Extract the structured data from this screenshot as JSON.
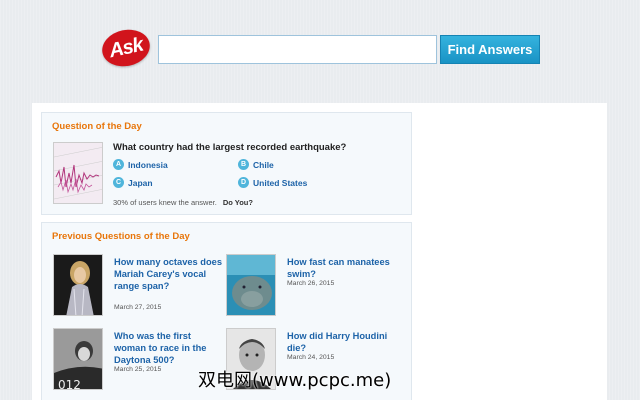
{
  "header": {
    "logo_text": "Ask",
    "search_placeholder": "",
    "search_button": "Find Answers"
  },
  "question_of_the_day": {
    "title": "Question of the Day",
    "question": "What country had the largest recorded earthquake?",
    "answers": [
      {
        "letter": "A",
        "text": "Indonesia"
      },
      {
        "letter": "B",
        "text": "Chile"
      },
      {
        "letter": "C",
        "text": "Japan"
      },
      {
        "letter": "D",
        "text": "United States"
      }
    ],
    "stat": "30% of users knew the answer.",
    "stat_cta": "Do You?"
  },
  "previous_questions": {
    "title": "Previous Questions of the Day",
    "items": [
      {
        "question": "How many octaves does Mariah Carey's vocal range span?",
        "date": "March 27, 2015"
      },
      {
        "question": "How fast can manatees swim?",
        "date": "March 26, 2015"
      },
      {
        "question": "Who was the first woman to race in the Daytona 500?",
        "date": "March 25, 2015"
      },
      {
        "question": "How did Harry Houdini die?",
        "date": "March 24, 2015"
      }
    ]
  },
  "watermark": "双电网(www.pcpc.me)",
  "colors": {
    "accent_orange": "#e8760b",
    "link_blue": "#1d63a8",
    "button_blue": "#1993c5",
    "logo_red": "#d1141c"
  }
}
